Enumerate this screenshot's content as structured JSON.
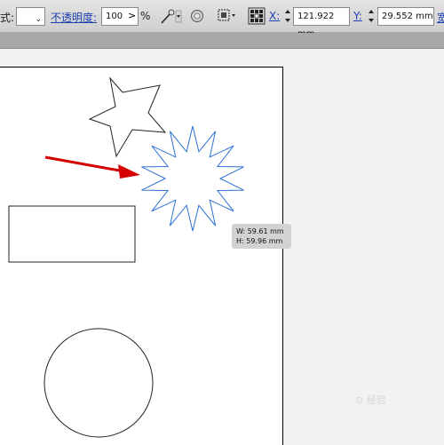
{
  "toolbar": {
    "style_label_tail": "式:",
    "opacity_label": "不透明度:",
    "opacity_value": "100",
    "opacity_unit": "%",
    "x_label": "X:",
    "x_value": "121.922 mm",
    "y_label": "Y:",
    "y_value": "29.552 mm",
    "width_label_partial": "宽"
  },
  "tooltip": {
    "width": "W: 59.61 mm",
    "height": "H: 59.96 mm"
  },
  "watermark": "⊙ 经验",
  "colors": {
    "selection": "#2a6fd4",
    "arrow": "#d40000",
    "link": "#1a3fb0"
  }
}
